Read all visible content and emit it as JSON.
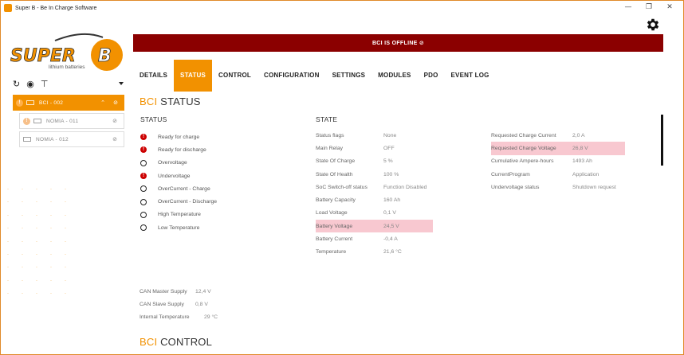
{
  "window": {
    "title": "Super B - Be In Charge Software"
  },
  "logo": {
    "brand": "SUPER B",
    "tagline": "lithium batteries"
  },
  "banner": {
    "text": "BCI IS OFFLINE"
  },
  "tabs": [
    {
      "label": "DETAILS",
      "active": false
    },
    {
      "label": "STATUS",
      "active": true
    },
    {
      "label": "CONTROL",
      "active": false
    },
    {
      "label": "CONFIGURATION",
      "active": false
    },
    {
      "label": "SETTINGS",
      "active": false
    },
    {
      "label": "MODULES",
      "active": false
    },
    {
      "label": "PDO",
      "active": false
    },
    {
      "label": "EVENT LOG",
      "active": false
    }
  ],
  "devices": [
    {
      "label": "BCI - 002"
    },
    {
      "label": "NOMIA - 011"
    },
    {
      "label": "NOMIA - 012"
    }
  ],
  "bci_status_title": {
    "accent": "BCI",
    "rest": "STATUS"
  },
  "bci_control_title": {
    "accent": "BCI",
    "rest": "CONTROL"
  },
  "status": {
    "heading": "STATUS",
    "items": [
      {
        "label": "Ready for charge",
        "state": "error"
      },
      {
        "label": "Ready for discharge",
        "state": "error"
      },
      {
        "label": "Overvoltage",
        "state": "ok"
      },
      {
        "label": "Undervoltage",
        "state": "error"
      },
      {
        "label": "OverCurrent - Charge",
        "state": "ok"
      },
      {
        "label": "OverCurrent - Discharge",
        "state": "ok"
      },
      {
        "label": "High Temperature",
        "state": "ok"
      },
      {
        "label": "Low Temperature",
        "state": "ok"
      }
    ]
  },
  "state": {
    "heading": "STATE",
    "col1": [
      {
        "k": "Status flags",
        "v": "None",
        "hl": false
      },
      {
        "k": "Main Relay",
        "v": "OFF",
        "hl": false
      },
      {
        "k": "State Of Charge",
        "v": "5 %",
        "hl": false
      },
      {
        "k": "State Of Health",
        "v": "100 %",
        "hl": false
      },
      {
        "k": "SoC Switch-off status",
        "v": "Function Disabled",
        "hl": false
      },
      {
        "k": "Battery Capacity",
        "v": "160 Ah",
        "hl": false
      },
      {
        "k": "Load Voltage",
        "v": "0,1 V",
        "hl": false
      },
      {
        "k": "Battery Voltage",
        "v": "24,5 V",
        "hl": true
      },
      {
        "k": "Battery Current",
        "v": "-0,4 A",
        "hl": false
      },
      {
        "k": "Temperature",
        "v": "21,6 °C",
        "hl": false
      }
    ],
    "col2": [
      {
        "k": "Requested Charge Current",
        "v": "2,0 A",
        "hl": false
      },
      {
        "k": "Requested Charge Voltage",
        "v": "26,8 V",
        "hl": true
      },
      {
        "k": "Cumulative Ampere-hours",
        "v": "1493 Ah",
        "hl": false
      },
      {
        "k": "CurrentProgram",
        "v": "Application",
        "hl": false
      },
      {
        "k": "Undervoltage status",
        "v": "Shutdown request",
        "hl": false
      }
    ]
  },
  "supplies": [
    {
      "k": "CAN Master Supply",
      "v": "12,4 V"
    },
    {
      "k": "CAN Slave Supply",
      "v": "0,8 V"
    },
    {
      "k": "Internal Temperature",
      "v": "29 °C"
    }
  ],
  "colors": {
    "accent": "#f29100",
    "banner": "#8b0000",
    "highlight": "#f8c8d0",
    "error": "#cc0000"
  }
}
